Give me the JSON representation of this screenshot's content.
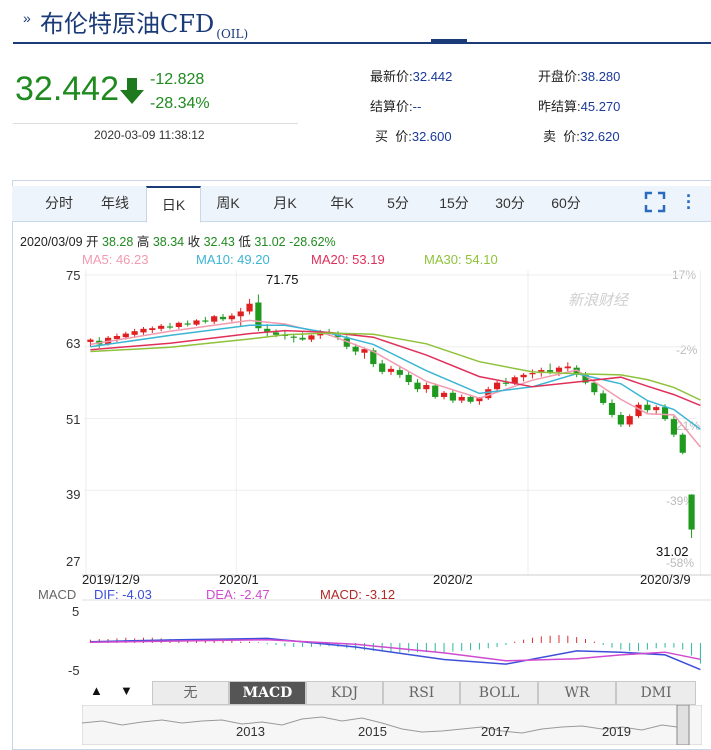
{
  "header": {
    "title": "布伦特原油CFD",
    "code": "(OIL)"
  },
  "quote": {
    "price": "32.442",
    "change": "-12.828",
    "change_pct": "-28.34%",
    "timestamp": "2020-03-09 11:38:12",
    "fields": [
      {
        "label": "最新价:",
        "value": "32.442"
      },
      {
        "label": "开盘价:",
        "value": "38.280"
      },
      {
        "label": "结算价:",
        "value": "--"
      },
      {
        "label": "昨结算:",
        "value": "45.270"
      },
      {
        "label": "买  价:",
        "value": "32.600"
      },
      {
        "label": "卖  价:",
        "value": "32.620"
      }
    ]
  },
  "tabs": [
    "分时",
    "年线",
    "日K",
    "周K",
    "月K",
    "年K",
    "5分",
    "15分",
    "30分",
    "60分"
  ],
  "active_tab": "日K",
  "ohlc": {
    "date": "2020/03/09",
    "open_label": "开",
    "open": "38.28",
    "high_label": "高",
    "high": "38.34",
    "close_label": "收",
    "close": "32.43",
    "low_label": "低",
    "low": "31.02",
    "change": "-28.62%"
  },
  "ma": [
    {
      "label": "MA5: 46.23",
      "color": "#f29ab0"
    },
    {
      "label": "MA10: 49.20",
      "color": "#3bb5d4"
    },
    {
      "label": "MA20: 53.19",
      "color": "#e0305a"
    },
    {
      "label": "MA30: 54.10",
      "color": "#8ec23a"
    }
  ],
  "y_ticks": [
    "75",
    "63",
    "51",
    "39",
    "27"
  ],
  "pct_ticks": [
    "17%",
    "-2%",
    "-21%",
    "-39%",
    "-58%"
  ],
  "x_ticks": [
    "2019/12/9",
    "2020/1",
    "2020/2",
    "2020/3/9"
  ],
  "annotations": {
    "high": "71.75",
    "low": "31.02"
  },
  "watermark": "新浪财经",
  "macd": {
    "label": "MACD",
    "dif": "DIF: -4.03",
    "dea": "DEA: -2.47",
    "macd": "MACD: -3.12",
    "y_top": "5",
    "y_bottom": "-5"
  },
  "indicators": [
    "无",
    "MACD",
    "KDJ",
    "RSI",
    "BOLL",
    "WR",
    "DMI"
  ],
  "active_indicator": "MACD",
  "nav_years": [
    "2013",
    "2015",
    "2017",
    "2019"
  ],
  "colors": {
    "up": "#e02020",
    "down": "#1f9a1f",
    "brand": "#1a3a78"
  },
  "chart_data": {
    "type": "candlestick",
    "x_range": [
      "2019/12/9",
      "2020/3/9"
    ],
    "ylim": [
      27,
      75
    ],
    "candles": [
      {
        "o": 63.8,
        "h": 64.4,
        "l": 63.0,
        "c": 64.2
      },
      {
        "o": 64.0,
        "h": 64.6,
        "l": 62.8,
        "c": 63.4
      },
      {
        "o": 63.4,
        "h": 64.8,
        "l": 63.2,
        "c": 64.5
      },
      {
        "o": 64.3,
        "h": 65.2,
        "l": 63.8,
        "c": 64.8
      },
      {
        "o": 64.6,
        "h": 65.5,
        "l": 64.2,
        "c": 65.2
      },
      {
        "o": 65.0,
        "h": 66.0,
        "l": 64.7,
        "c": 65.6
      },
      {
        "o": 65.4,
        "h": 66.3,
        "l": 65.0,
        "c": 66.0
      },
      {
        "o": 65.8,
        "h": 66.4,
        "l": 65.3,
        "c": 66.1
      },
      {
        "o": 66.0,
        "h": 66.8,
        "l": 65.6,
        "c": 66.5
      },
      {
        "o": 66.4,
        "h": 67.0,
        "l": 65.9,
        "c": 66.2
      },
      {
        "o": 66.3,
        "h": 67.2,
        "l": 66.0,
        "c": 67.0
      },
      {
        "o": 66.9,
        "h": 67.4,
        "l": 66.4,
        "c": 66.7
      },
      {
        "o": 66.7,
        "h": 67.6,
        "l": 66.5,
        "c": 67.4
      },
      {
        "o": 67.4,
        "h": 68.0,
        "l": 66.9,
        "c": 67.2
      },
      {
        "o": 67.2,
        "h": 68.3,
        "l": 66.8,
        "c": 68.1
      },
      {
        "o": 68.0,
        "h": 68.5,
        "l": 67.3,
        "c": 67.6
      },
      {
        "o": 67.6,
        "h": 68.6,
        "l": 67.2,
        "c": 68.2
      },
      {
        "o": 68.1,
        "h": 69.5,
        "l": 66.5,
        "c": 68.9
      },
      {
        "o": 68.9,
        "h": 71.0,
        "l": 68.4,
        "c": 70.2
      },
      {
        "o": 70.4,
        "h": 71.75,
        "l": 65.6,
        "c": 66.1
      },
      {
        "o": 66.0,
        "h": 66.8,
        "l": 64.7,
        "c": 65.4
      },
      {
        "o": 65.4,
        "h": 65.9,
        "l": 64.6,
        "c": 65.0
      },
      {
        "o": 65.0,
        "h": 65.7,
        "l": 64.2,
        "c": 64.8
      },
      {
        "o": 64.7,
        "h": 65.2,
        "l": 63.7,
        "c": 64.5
      },
      {
        "o": 64.5,
        "h": 65.4,
        "l": 64.0,
        "c": 64.2
      },
      {
        "o": 64.2,
        "h": 65.0,
        "l": 63.8,
        "c": 64.9
      },
      {
        "o": 64.9,
        "h": 65.8,
        "l": 64.3,
        "c": 65.3
      },
      {
        "o": 65.3,
        "h": 66.0,
        "l": 64.8,
        "c": 65.2
      },
      {
        "o": 65.0,
        "h": 65.6,
        "l": 64.1,
        "c": 64.6
      },
      {
        "o": 64.4,
        "h": 64.9,
        "l": 62.6,
        "c": 63.0
      },
      {
        "o": 63.0,
        "h": 63.5,
        "l": 61.6,
        "c": 62.2
      },
      {
        "o": 62.0,
        "h": 62.9,
        "l": 61.0,
        "c": 62.6
      },
      {
        "o": 62.4,
        "h": 62.8,
        "l": 59.6,
        "c": 60.1
      },
      {
        "o": 60.2,
        "h": 60.8,
        "l": 58.4,
        "c": 58.8
      },
      {
        "o": 58.8,
        "h": 59.8,
        "l": 58.3,
        "c": 59.3
      },
      {
        "o": 59.1,
        "h": 59.6,
        "l": 57.8,
        "c": 58.3
      },
      {
        "o": 58.3,
        "h": 58.9,
        "l": 56.6,
        "c": 57.1
      },
      {
        "o": 57.0,
        "h": 57.6,
        "l": 55.4,
        "c": 55.9
      },
      {
        "o": 55.9,
        "h": 57.0,
        "l": 55.3,
        "c": 56.6
      },
      {
        "o": 56.5,
        "h": 56.9,
        "l": 54.3,
        "c": 54.6
      },
      {
        "o": 54.6,
        "h": 55.6,
        "l": 54.2,
        "c": 55.3
      },
      {
        "o": 55.3,
        "h": 55.8,
        "l": 53.6,
        "c": 54.0
      },
      {
        "o": 54.0,
        "h": 55.0,
        "l": 53.6,
        "c": 54.6
      },
      {
        "o": 54.6,
        "h": 55.0,
        "l": 53.5,
        "c": 53.8
      },
      {
        "o": 53.9,
        "h": 54.6,
        "l": 53.3,
        "c": 54.4
      },
      {
        "o": 54.4,
        "h": 56.3,
        "l": 54.1,
        "c": 55.9
      },
      {
        "o": 55.9,
        "h": 57.3,
        "l": 55.5,
        "c": 57.0
      },
      {
        "o": 57.0,
        "h": 57.8,
        "l": 56.4,
        "c": 56.8
      },
      {
        "o": 56.9,
        "h": 58.2,
        "l": 56.6,
        "c": 57.9
      },
      {
        "o": 57.9,
        "h": 58.6,
        "l": 57.2,
        "c": 58.3
      },
      {
        "o": 58.4,
        "h": 59.2,
        "l": 57.7,
        "c": 58.6
      },
      {
        "o": 58.6,
        "h": 59.5,
        "l": 58.0,
        "c": 59.1
      },
      {
        "o": 59.1,
        "h": 60.2,
        "l": 58.4,
        "c": 58.8
      },
      {
        "o": 58.8,
        "h": 59.8,
        "l": 58.1,
        "c": 59.5
      },
      {
        "o": 59.4,
        "h": 60.4,
        "l": 58.9,
        "c": 59.7
      },
      {
        "o": 59.5,
        "h": 59.9,
        "l": 57.9,
        "c": 58.3
      },
      {
        "o": 58.3,
        "h": 58.8,
        "l": 56.7,
        "c": 57.0
      },
      {
        "o": 57.0,
        "h": 57.4,
        "l": 54.9,
        "c": 55.4
      },
      {
        "o": 55.2,
        "h": 55.7,
        "l": 53.3,
        "c": 53.6
      },
      {
        "o": 53.6,
        "h": 54.2,
        "l": 51.2,
        "c": 51.6
      },
      {
        "o": 51.6,
        "h": 52.1,
        "l": 49.6,
        "c": 50.0
      },
      {
        "o": 50.0,
        "h": 51.7,
        "l": 49.6,
        "c": 51.4
      },
      {
        "o": 51.4,
        "h": 53.7,
        "l": 51.1,
        "c": 53.3
      },
      {
        "o": 53.3,
        "h": 54.0,
        "l": 52.0,
        "c": 52.4
      },
      {
        "o": 52.4,
        "h": 53.2,
        "l": 51.6,
        "c": 52.9
      },
      {
        "o": 52.9,
        "h": 53.4,
        "l": 50.6,
        "c": 50.9
      },
      {
        "o": 50.9,
        "h": 51.4,
        "l": 47.9,
        "c": 48.3
      },
      {
        "o": 48.3,
        "h": 48.6,
        "l": 45.0,
        "c": 45.27
      },
      {
        "o": 38.28,
        "h": 38.34,
        "l": 31.02,
        "c": 32.43
      }
    ],
    "ma": {
      "MA5": {
        "color": "#f29ab0",
        "points": [
          [
            0,
            63.4
          ],
          [
            9,
            65.6
          ],
          [
            18,
            67.4
          ],
          [
            22,
            66.8
          ],
          [
            27,
            65.0
          ],
          [
            32,
            62.2
          ],
          [
            38,
            57.2
          ],
          [
            44,
            54.4
          ],
          [
            50,
            57.4
          ],
          [
            55,
            59.1
          ],
          [
            60,
            54.2
          ],
          [
            63,
            51.8
          ],
          [
            66,
            51.6
          ],
          [
            69,
            46.23
          ]
        ]
      },
      "MA10": {
        "color": "#3bb5d4",
        "points": [
          [
            0,
            63.0
          ],
          [
            9,
            64.9
          ],
          [
            18,
            66.6
          ],
          [
            22,
            66.6
          ],
          [
            27,
            65.3
          ],
          [
            32,
            63.4
          ],
          [
            38,
            59.0
          ],
          [
            44,
            55.2
          ],
          [
            50,
            56.3
          ],
          [
            55,
            58.5
          ],
          [
            60,
            56.8
          ],
          [
            63,
            54.0
          ],
          [
            66,
            52.5
          ],
          [
            69,
            49.2
          ]
        ]
      },
      "MA20": {
        "color": "#e0305a",
        "points": [
          [
            0,
            62.5
          ],
          [
            9,
            63.6
          ],
          [
            18,
            65.2
          ],
          [
            22,
            65.7
          ],
          [
            27,
            65.4
          ],
          [
            32,
            64.6
          ],
          [
            38,
            61.6
          ],
          [
            44,
            58.0
          ],
          [
            50,
            56.3
          ],
          [
            55,
            57.1
          ],
          [
            60,
            57.9
          ],
          [
            63,
            56.4
          ],
          [
            66,
            55.0
          ],
          [
            69,
            53.19
          ]
        ]
      },
      "MA30": {
        "color": "#8ec23a",
        "points": [
          [
            0,
            62.2
          ],
          [
            9,
            62.9
          ],
          [
            18,
            64.3
          ],
          [
            22,
            65.0
          ],
          [
            27,
            65.3
          ],
          [
            32,
            65.1
          ],
          [
            38,
            63.5
          ],
          [
            44,
            60.5
          ],
          [
            50,
            58.8
          ],
          [
            55,
            58.5
          ],
          [
            60,
            58.3
          ],
          [
            63,
            57.5
          ],
          [
            66,
            56.2
          ],
          [
            69,
            54.1
          ]
        ]
      }
    },
    "macd_hist": [
      0.5,
      0.6,
      0.6,
      0.7,
      0.8,
      0.7,
      0.8,
      0.8,
      0.7,
      0.6,
      0.5,
      0.5,
      0.4,
      0.4,
      0.4,
      0.3,
      0.3,
      0.2,
      0.2,
      0.1,
      -0.2,
      -0.3,
      -0.5,
      -0.6,
      -0.6,
      -0.6,
      -0.5,
      -0.5,
      -0.6,
      -0.8,
      -1.0,
      -1.1,
      -1.2,
      -1.3,
      -1.4,
      -1.4,
      -1.4,
      -1.4,
      -1.4,
      -1.4,
      -1.4,
      -1.3,
      -1.2,
      -1.1,
      -1.0,
      -0.8,
      -0.6,
      -0.3,
      0.2,
      0.5,
      0.8,
      1.0,
      1.1,
      1.2,
      1.1,
      0.9,
      0.6,
      0.2,
      -0.3,
      -0.7,
      -1.0,
      -1.2,
      -1.2,
      -1.0,
      -0.8,
      -0.7,
      -0.7,
      -1.0,
      -1.9,
      -3.12
    ],
    "macd_dif": [
      [
        0,
        0.2
      ],
      [
        10,
        0.5
      ],
      [
        20,
        0.7
      ],
      [
        30,
        -0.6
      ],
      [
        40,
        -2.5
      ],
      [
        47,
        -3.2
      ],
      [
        55,
        -1.2
      ],
      [
        60,
        -1.4
      ],
      [
        65,
        -1.8
      ],
      [
        69,
        -4.03
      ]
    ],
    "macd_dea": [
      [
        0,
        0.1
      ],
      [
        10,
        0.3
      ],
      [
        20,
        0.5
      ],
      [
        30,
        -0.2
      ],
      [
        40,
        -1.5
      ],
      [
        47,
        -2.7
      ],
      [
        55,
        -2.4
      ],
      [
        60,
        -1.8
      ],
      [
        65,
        -1.4
      ],
      [
        69,
        -2.47
      ]
    ],
    "macd_ylim": [
      -5,
      5
    ]
  }
}
